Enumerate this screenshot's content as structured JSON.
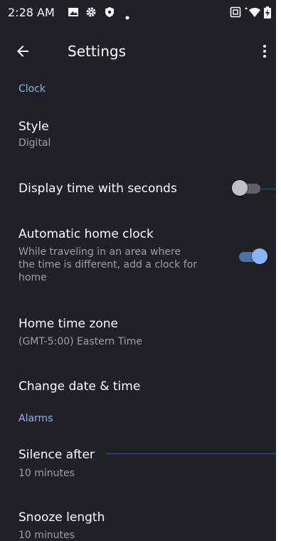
{
  "status_bar": {
    "time": "2:28 AM",
    "left_icons": [
      "gallery-icon",
      "gear-icon",
      "shield-icon",
      "dot-icon"
    ],
    "right_icons": [
      "screenshot-icon",
      "wifi-icon",
      "battery-icon"
    ]
  },
  "app_bar": {
    "title": "Settings",
    "back_icon": "arrow-back-icon",
    "menu_icon": "more-vert-icon"
  },
  "sections": {
    "clock": {
      "header": "Clock"
    },
    "alarms": {
      "header": "Alarms"
    }
  },
  "items": {
    "style": {
      "title": "Style",
      "summary": "Digital"
    },
    "seconds": {
      "title": "Display time with seconds",
      "toggle": false
    },
    "auto_home": {
      "title": "Automatic home clock",
      "summary_lines": [
        "While traveling in an area where",
        "the time is different, add a clock for",
        "home"
      ],
      "toggle": true
    },
    "home_tz": {
      "title": "Home time zone",
      "summary": "(GMT-5:00) Eastern Time"
    },
    "change_dt": {
      "title": "Change date & time"
    },
    "silence": {
      "title": "Silence after",
      "summary": "10 minutes"
    },
    "snooze": {
      "title": "Snooze length",
      "summary": "10 minutes"
    }
  },
  "colors": {
    "background": "#202124",
    "accent": "#8ab4f8",
    "annotation_line": "#c5221f"
  }
}
